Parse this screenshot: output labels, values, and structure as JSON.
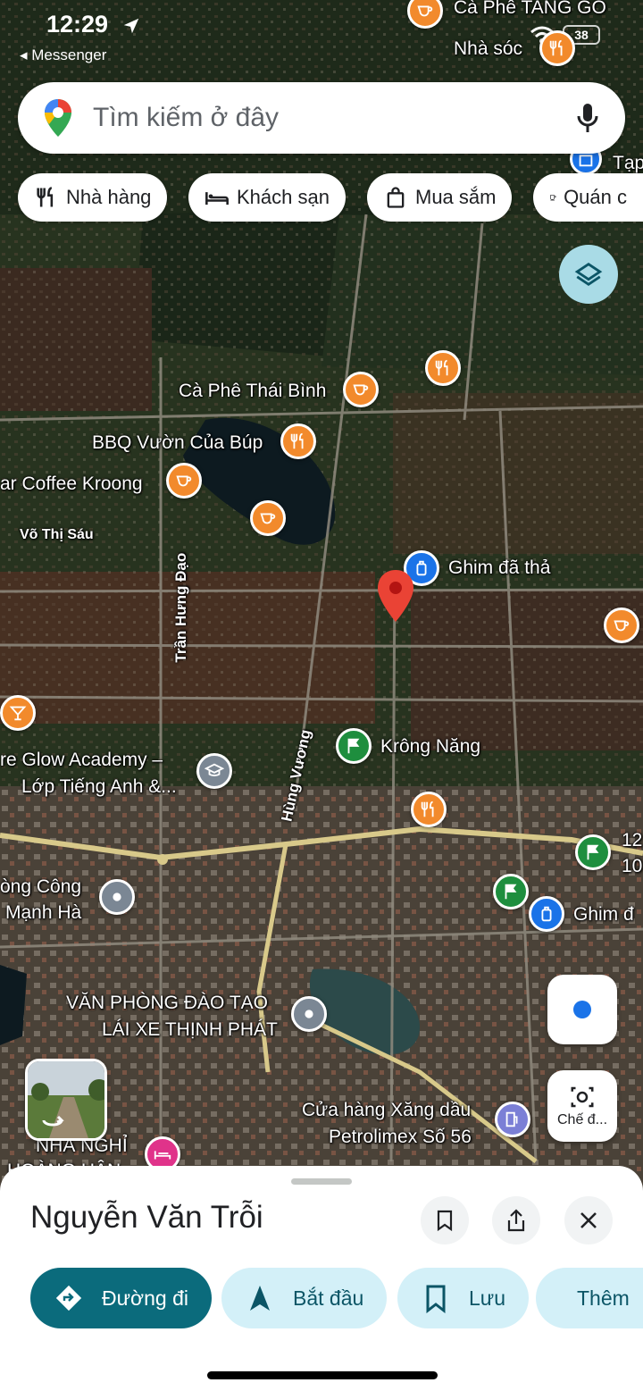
{
  "status_bar": {
    "time": "12:29",
    "back_app": "◂ Messenger",
    "battery": "38"
  },
  "search": {
    "placeholder": "Tìm kiếm ở đây"
  },
  "chips": [
    {
      "label": "Nhà hàng",
      "icon": "restaurant-icon"
    },
    {
      "label": "Khách sạn",
      "icon": "hotel-icon"
    },
    {
      "label": "Mua sắm",
      "icon": "shopping-bag-icon"
    },
    {
      "label": "Quán c",
      "icon": "cafe-icon"
    }
  ],
  "map_labels": {
    "ca_phe_tang_go": "Cà Phê TANG GO",
    "nha_soc": "Nhà sóc",
    "tap": "Tạp",
    "ca_phe_thai_binh": "Cà Phê Thái Bình",
    "bbq": "BBQ Vườn Của Búp",
    "coffee_kroong": "ar Coffee Kroong",
    "vo_thi_sau": "Võ Thị Sáu",
    "tran_hung_dao": "Trần Hưng Đạo",
    "ghim_da_tha": "Ghim đã thả",
    "glow_academy_1": "re Glow Academy –",
    "glow_academy_2": "Lớp Tiếng Anh &...",
    "hung_vuong": "Hùng Vương",
    "krong_nang": "Krông Năng",
    "num_12": "12",
    "num_10": "10",
    "ong_cong": "òng Công",
    "manh_ha": "Mạnh Hà",
    "ghim_d": "Ghim đ",
    "van_phong_1": "VĂN PHÒNG ĐÀO TẠO",
    "van_phong_2": "LÁI XE THỊNH PHÁT",
    "xang_dau_1": "Cửa hàng Xăng dầu",
    "xang_dau_2": "Petrolimex Số 56",
    "nha_nghi_1": "NHÀ NGHỈ",
    "nha_nghi_2": "HOÀNG HÂN"
  },
  "lens_label": "Chế đ...",
  "place": {
    "title": "Nguyễn Văn Trỗi",
    "actions": [
      {
        "label": "Đường đi",
        "icon": "directions-icon"
      },
      {
        "label": "Bắt đầu",
        "icon": "navigation-icon"
      },
      {
        "label": "Lưu",
        "icon": "bookmark-icon"
      },
      {
        "label": "Thêm",
        "icon": "flag-icon"
      }
    ]
  },
  "colors": {
    "accent": "#0b6b7c",
    "action_bg": "#d3f0f8",
    "pin": "#ea4335"
  }
}
